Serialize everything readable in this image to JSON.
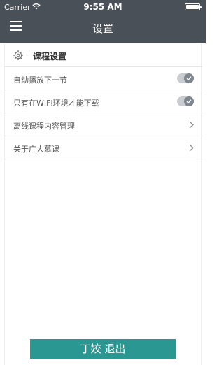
{
  "status_bar": {
    "carrier": "Carrier",
    "time": "9:55 AM",
    "icons": [
      "wifi-icon",
      "battery-icon"
    ]
  },
  "header": {
    "title": "设置",
    "menu_icon": "menu-icon",
    "background_color": "#4a5057"
  },
  "settings": {
    "section_title": "课程设置",
    "section_icon": "gear-icon",
    "items": [
      {
        "label": "自动播放下一节",
        "control": "toggle",
        "state": true
      },
      {
        "label": "只有在WIFI环境才能下载",
        "control": "toggle",
        "state": true
      },
      {
        "label": "离线课程内容管理",
        "control": "chevron-right-icon"
      },
      {
        "label": "关于广大慕课",
        "control": "chevron-right-icon"
      }
    ]
  },
  "logout": {
    "label": "丁姣 退出",
    "color": "#2b9793"
  }
}
